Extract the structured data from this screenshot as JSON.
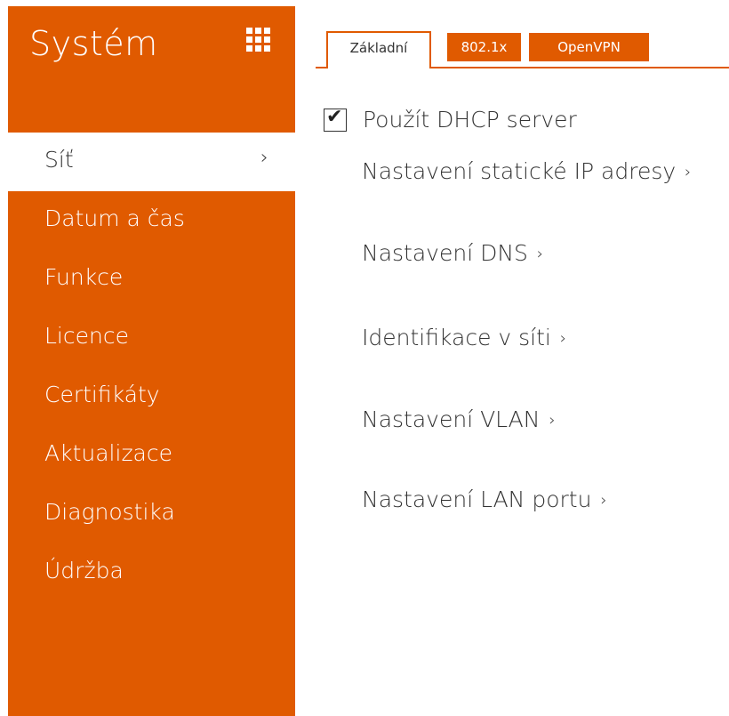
{
  "sidebar": {
    "title": "Systém",
    "menu_icon": "grid-icon",
    "items": [
      {
        "label": "Síť",
        "active": true,
        "chevron": "›"
      },
      {
        "label": "Datum a čas"
      },
      {
        "label": "Funkce"
      },
      {
        "label": "Licence"
      },
      {
        "label": "Certifikáty"
      },
      {
        "label": "Aktualizace"
      },
      {
        "label": "Diagnostika"
      },
      {
        "label": "Údržba"
      }
    ]
  },
  "tabs": [
    {
      "label": "Základní",
      "active": true
    },
    {
      "label": "802.1x"
    },
    {
      "label": "OpenVPN"
    }
  ],
  "main": {
    "dhcp": {
      "label": "Použít DHCP server",
      "checked": true,
      "check_glyph": "✔"
    },
    "links": [
      {
        "label": "Nastavení statické IP adresy",
        "chevron": "›"
      },
      {
        "label": "Nastavení DNS",
        "chevron": "›"
      },
      {
        "label": "Identifikace v síti",
        "chevron": "›"
      },
      {
        "label": "Nastavení VLAN",
        "chevron": "›"
      },
      {
        "label": "Nastavení LAN portu",
        "chevron": "›"
      }
    ]
  },
  "colors": {
    "accent": "#e05a00",
    "text": "#333333",
    "background": "#ffffff"
  }
}
